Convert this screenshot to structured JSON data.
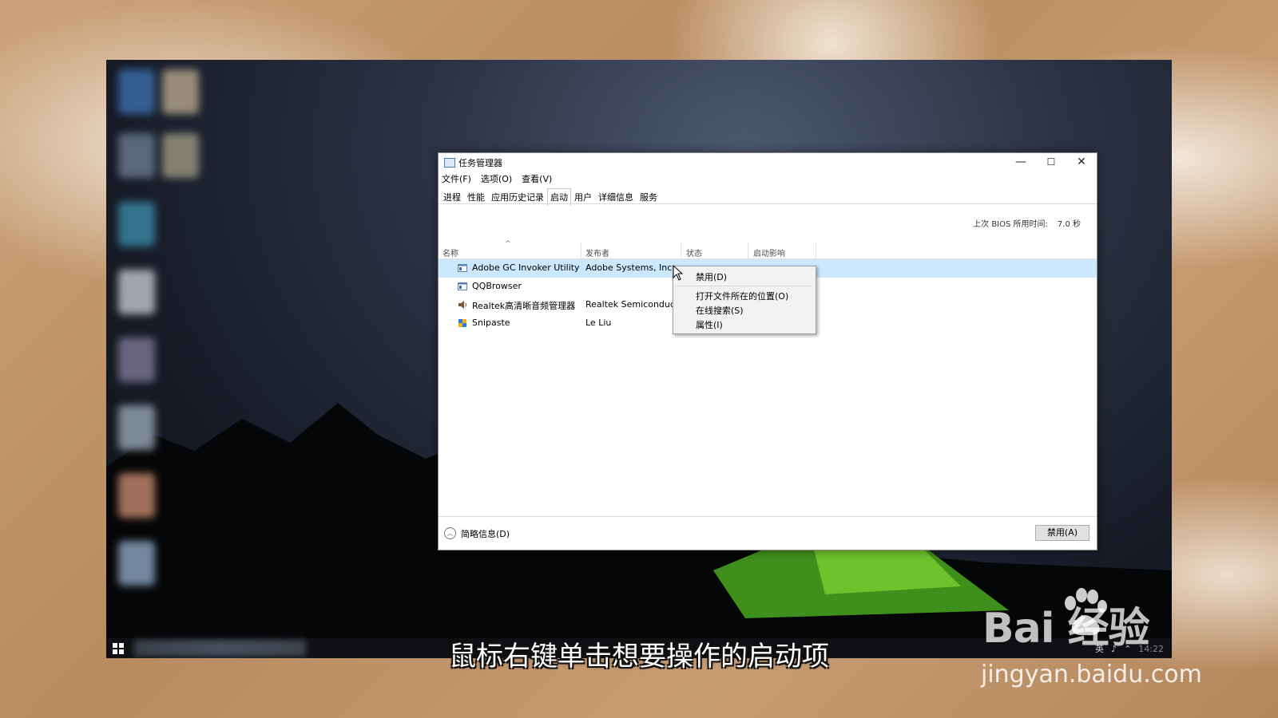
{
  "window": {
    "title": "任务管理器",
    "controls": {
      "minimize": "—",
      "maximize": "☐",
      "close": "✕"
    }
  },
  "menu": [
    "文件(F)",
    "选项(O)",
    "查看(V)"
  ],
  "tabs": [
    "进程",
    "性能",
    "应用历史记录",
    "启动",
    "用户",
    "详细信息",
    "服务"
  ],
  "active_tab": "启动",
  "bios": {
    "label": "上次 BIOS 所用时间:",
    "value": "7.0 秒"
  },
  "columns": [
    "名称",
    "发布者",
    "状态",
    "启动影响"
  ],
  "rows": [
    {
      "name": "Adobe GC Invoker Utility",
      "publisher": "Adobe Systems, Incor...",
      "icon": "app-window-icon",
      "selected": true
    },
    {
      "name": "QQBrowser",
      "publisher": "",
      "icon": "app-window-icon",
      "selected": false
    },
    {
      "name": "Realtek高清晰音频管理器",
      "publisher": "Realtek Semiconductor",
      "icon": "speaker-icon",
      "selected": false
    },
    {
      "name": "Snipaste",
      "publisher": "Le Liu",
      "icon": "snipaste-icon",
      "selected": false
    }
  ],
  "context_menu": [
    "禁用(D)",
    "打开文件所在的位置(O)",
    "在线搜索(S)",
    "属性(I)"
  ],
  "footer": {
    "fewer_details": "简略信息(D)",
    "disable_button": "禁用(A)"
  },
  "taskbar": {
    "tray_text": [
      "英",
      "♪",
      "⌃"
    ],
    "clock": "14:22"
  },
  "subtitle": "鼠标右键单击想要操作的启动项",
  "watermark": {
    "logo_text": "Bai  经验",
    "url": "jingyan.baidu.com"
  },
  "colors": {
    "selection": "#cce8ff",
    "accent": "#0078d7"
  }
}
